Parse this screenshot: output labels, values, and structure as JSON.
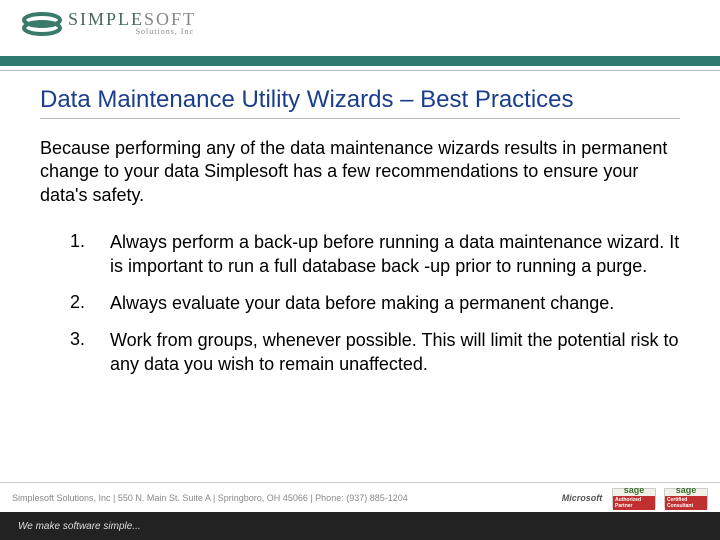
{
  "header": {
    "company_main": "SIMPLE",
    "company_soft": "SOFT",
    "company_sub": "Solutions, Inc"
  },
  "content": {
    "title": "Data Maintenance Utility Wizards – Best Practices",
    "intro": "Because performing any of the data maintenance wizards results in permanent change to your data Simplesoft has a few recommendations to ensure your data's safety.",
    "items": [
      {
        "num": "1.",
        "text": "Always perform a back-up before running a data maintenance wizard. It is important to run a full database back -up prior to running a purge."
      },
      {
        "num": "2.",
        "text": "Always evaluate your data before making a permanent change."
      },
      {
        "num": "3.",
        "text": "Work from groups, whenever possible. This will limit the potential risk to any data you wish to remain unaffected."
      }
    ]
  },
  "footer": {
    "info": "Simplesoft Solutions, Inc  |  550 N. Main St. Suite A  |  Springboro, OH 45066  |  Phone: (937) 885-1204",
    "partners": {
      "microsoft": "Microsoft",
      "sage1": "sage",
      "sage1_sub": "Authorized Partner",
      "sage2": "sage",
      "sage2_sub": "Certified Consultant"
    },
    "tagline": "We make software simple..."
  }
}
